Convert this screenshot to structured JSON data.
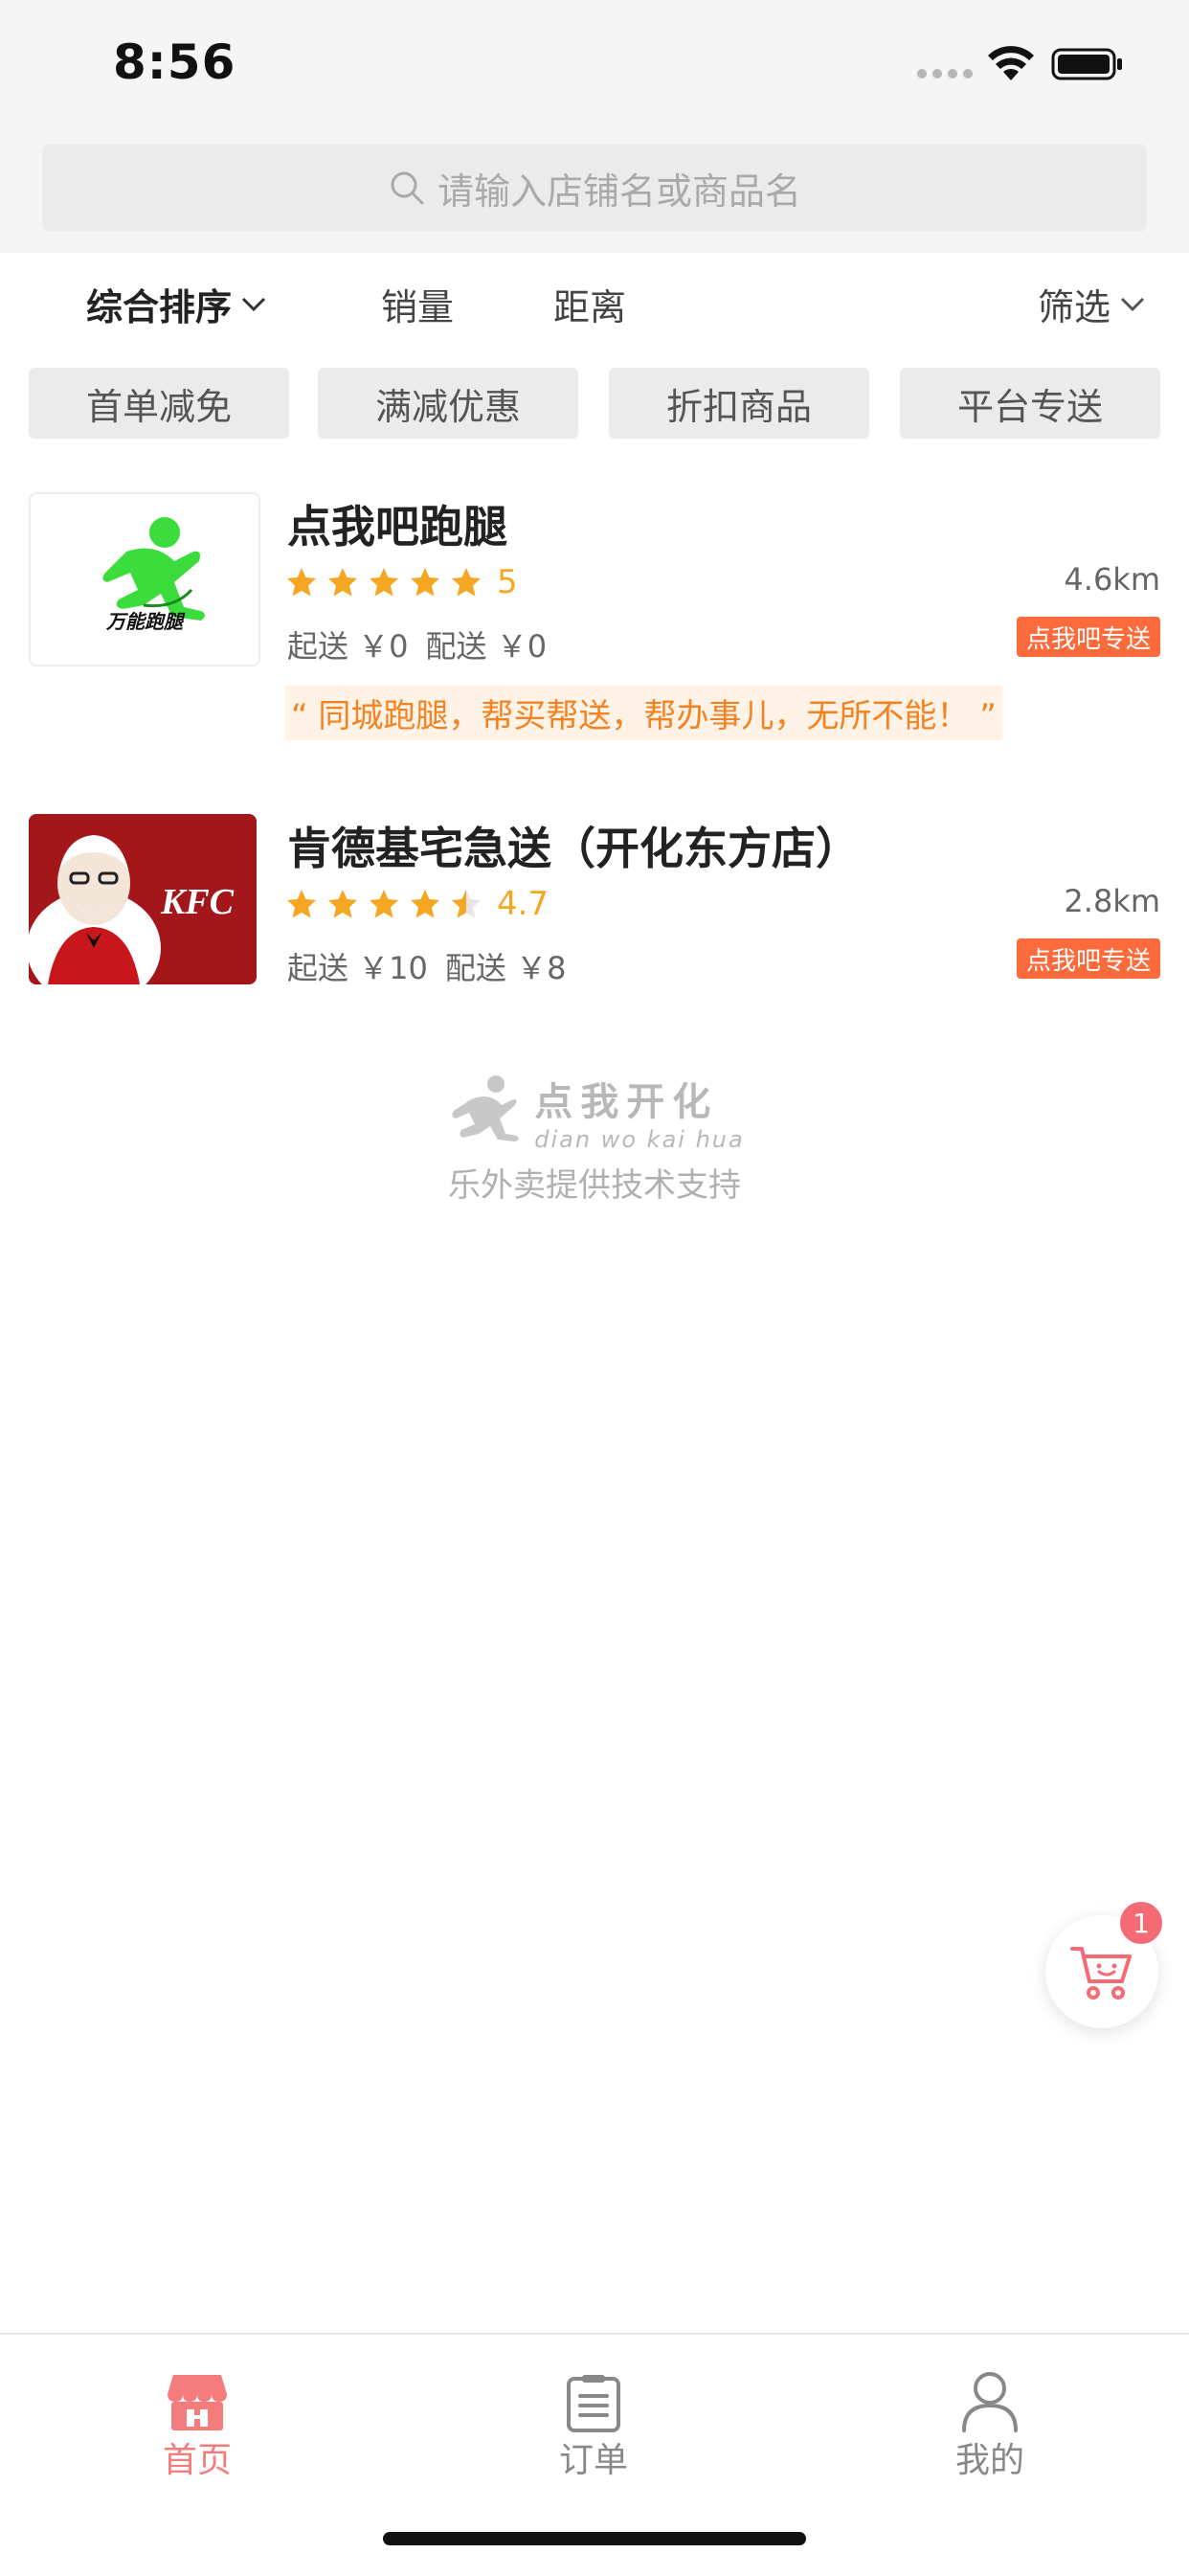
{
  "status_bar": {
    "time": "8:56"
  },
  "search": {
    "placeholder": "请输入店铺名或商品名"
  },
  "sort": {
    "main": "综合排序",
    "sales": "销量",
    "distance": "距离",
    "filter": "筛选"
  },
  "chips": [
    "首单减免",
    "满减优惠",
    "折扣商品",
    "平台专送"
  ],
  "shops": [
    {
      "name": "点我吧跑腿",
      "rating": "5",
      "rating_value": 5,
      "distance": "4.6km",
      "min_order": "起送 ￥0",
      "delivery_fee": "配送 ￥0",
      "tag": "点我吧专送",
      "slogan": "“ 同城跑腿，帮买帮送，帮办事儿，无所不能！ ”",
      "logo_text": "万能跑腿"
    },
    {
      "name": "肯德基宅急送（开化东方店）",
      "rating": "4.7",
      "rating_value": 4.7,
      "distance": "2.8km",
      "min_order": "起送 ￥10",
      "delivery_fee": "配送 ￥8",
      "tag": "点我吧专送",
      "logo_text": "KFC"
    }
  ],
  "support": {
    "brand": "点我开化",
    "brand_pinyin": "dian wo kai hua",
    "text": "乐外卖提供技术支持"
  },
  "cart": {
    "badge": "1"
  },
  "tabs": {
    "home": "首页",
    "orders": "订单",
    "me": "我的"
  },
  "colors": {
    "accent": "#f47c7c",
    "star": "#f5a623",
    "tag": "#fd6a3b",
    "slogan": "#f58220"
  }
}
